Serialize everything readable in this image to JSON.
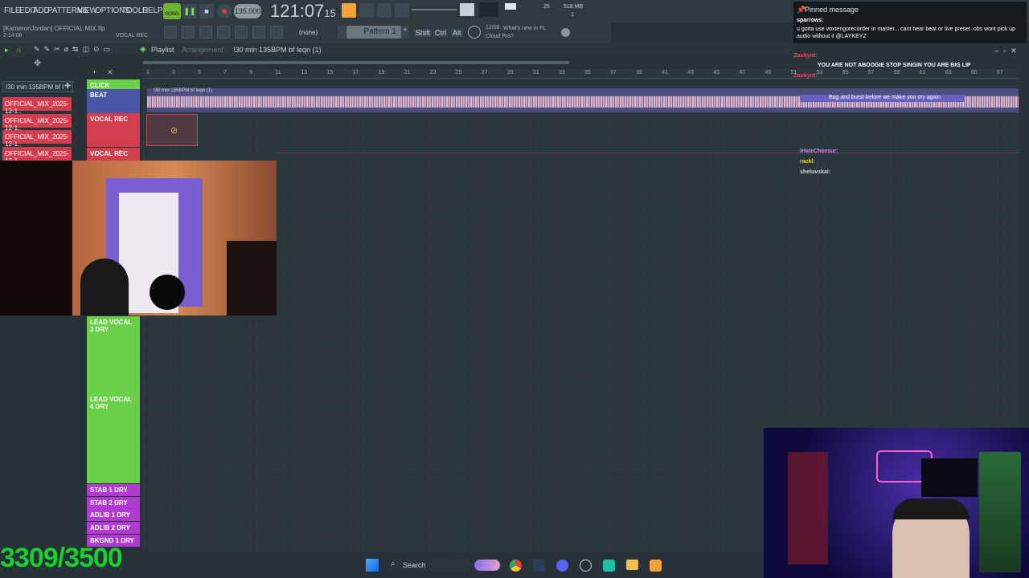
{
  "menu": [
    "FILE",
    "EDIT",
    "ADD",
    "PATTERNS",
    "VIEW",
    "OPTIONS",
    "TOOLS",
    "HELP"
  ],
  "song_mode": "SONG",
  "tempo": "135.000",
  "time": "121:07",
  "time_sub": "15",
  "cpu": "25",
  "memory": "518 MB",
  "mem_sub": "1",
  "project_file": "[KameronJordan] OFFICIAL MIX.flp",
  "project_time": "2:14:06",
  "hint": "VOCAL REC",
  "snap": "(none)",
  "pattern": "Pattern 1",
  "modifiers": [
    "Shift",
    "Ctrl",
    "Alt"
  ],
  "news_date": "12/09",
  "news_text": "What's new in FL Cloud Pro?",
  "playlist_title": "Playlist",
  "playlist_sub": "Arrangement",
  "clip_name": "!30 min 135BPM bf  leqn (1)",
  "clip_label": "!30 min 135BPM bf  leqn (1)",
  "left_browser_top": "!30 min 135BPM bf  l",
  "left_clips": [
    "OFFICIAL_MIX_2025-12-1..",
    "OFFICIAL_MIX_2025-12-1..",
    "OFFICIAL_MIX_2025-12-1..",
    "OFFICIAL_MIX_2025-12-1.."
  ],
  "tracks_top": [
    "CLICK",
    "BEAT",
    "VOCAL REC",
    "VOCAL REC"
  ],
  "tracks_green": [
    "LEAD VOCAL 3 DRY",
    "LEAD VOCAL 4 DRY"
  ],
  "tracks_purple": [
    "STAB 1 DRY",
    "STAB 2 DRY",
    "ADLIB 1 DRY",
    "ADLIB 2 DRY",
    "BKGND 1 DRY"
  ],
  "ruler": [
    "1",
    "3",
    "5",
    "7",
    "9",
    "11",
    "13",
    "15",
    "17",
    "19",
    "21",
    "23",
    "25",
    "27",
    "29",
    "31",
    "33",
    "35",
    "37",
    "39",
    "41",
    "43",
    "45",
    "47",
    "49",
    "51",
    "53",
    "55",
    "57",
    "59",
    "61",
    "63",
    "65",
    "67"
  ],
  "chat": {
    "pinned_title": "Pinned message",
    "pinned_user": "sparrows:",
    "pinned_text": "u gotta use voxtengorecorder in master... cant hear beat or live preset..obs wont pick up audio without it @LAYKEYZ",
    "messages": [
      {
        "user": "Zuukynt:",
        "text": "",
        "color": "#e0506a"
      },
      {
        "user": "Zuukynt:",
        "text": "",
        "color": "#e0506a"
      },
      {
        "user": "",
        "text": "YOU ARE NOT ABOOGIE STOP SINGIN YOU ARE BIG LIP",
        "color": "#e0506a"
      },
      {
        "user": "Zuukynt:",
        "text": "",
        "color": "#e0506a"
      },
      {
        "user": "",
        "text": "Bag and burst before we make you cry again",
        "color": "#8a7fe0"
      },
      {
        "user": "IHateCheesur:",
        "text": "",
        "color": "#c08ae8"
      },
      {
        "user": "rackl:",
        "text": "",
        "color": "#e8d25a"
      },
      {
        "user": "sheluvskai:",
        "text": "",
        "color": "#d6d6d6"
      }
    ]
  },
  "counter": "3309/3500",
  "taskbar": {
    "search": "Search"
  },
  "colors": {
    "accent_orange": "#f2a43a",
    "track_green": "#6ad04a",
    "track_red": "#d23e4d",
    "track_purple": "#b13bd0",
    "counter": "#1ecc34"
  }
}
